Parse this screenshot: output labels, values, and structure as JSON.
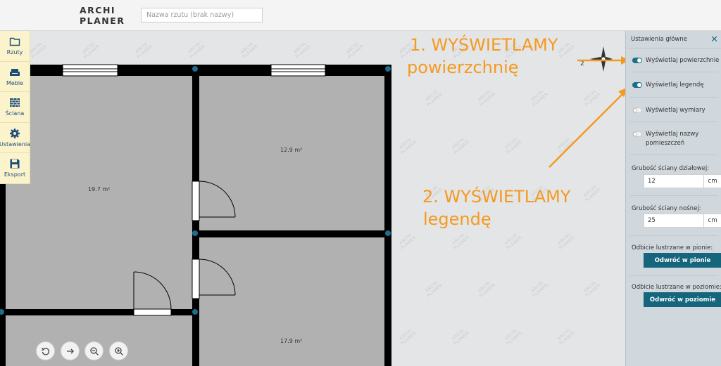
{
  "app": {
    "logo_line1": "ARCHI",
    "logo_line2": "PLANER",
    "plan_name_placeholder": "Nazwa rzutu (brak nazwy)",
    "watermark_line1": "ARCHI",
    "watermark_line2": "PLANER"
  },
  "toolbar": {
    "items": [
      {
        "label": "Rzuty",
        "icon": "folder-icon"
      },
      {
        "label": "Meble",
        "icon": "armchair-icon"
      },
      {
        "label": "Ściana",
        "icon": "brick-wall-icon"
      },
      {
        "label": "Ustawienia",
        "icon": "gear-icon"
      },
      {
        "label": "Eksport",
        "icon": "floppy-disk-icon"
      }
    ]
  },
  "rooms": [
    {
      "area": "19.7 m²"
    },
    {
      "area": "12.9 m²"
    },
    {
      "area": "17.9 m²"
    }
  ],
  "zoom": {
    "controls": [
      "undo-icon",
      "arrow-right-icon",
      "zoom-out-icon",
      "zoom-in-icon"
    ]
  },
  "annotations": {
    "step1_line1": "1. WYŚWIETLAMY",
    "step1_line2": "powierzchnię",
    "step2_line1": "2. WYŚWIETLAMY",
    "step2_line2": "legendę",
    "color": "#f59a20"
  },
  "panel": {
    "title": "Ustawienia główne",
    "close_icon": "close-icon",
    "toggles": [
      {
        "label": "Wyświetlaj powierzchnie",
        "on": true
      },
      {
        "label": "Wyświetlaj legendę",
        "on": true
      },
      {
        "label": "Wyświetlaj wymiary",
        "on": false
      },
      {
        "label": "Wyświetlaj nazwy pomieszczeń",
        "on": false
      }
    ],
    "partition_wall": {
      "label": "Grubość ściany działowej:",
      "value": "12",
      "unit": "cm"
    },
    "load_wall": {
      "label": "Grubość ściany nośnej:",
      "value": "25",
      "unit": "cm"
    },
    "mirror_vertical": {
      "label": "Odbicie lustrzane w pionie:",
      "button": "Odwróć w pionie"
    },
    "mirror_horizontal": {
      "label": "Odbicie lustrzane w poziomie:",
      "button": "Odwróć w poziomie"
    },
    "accent_color": "#15667c"
  }
}
